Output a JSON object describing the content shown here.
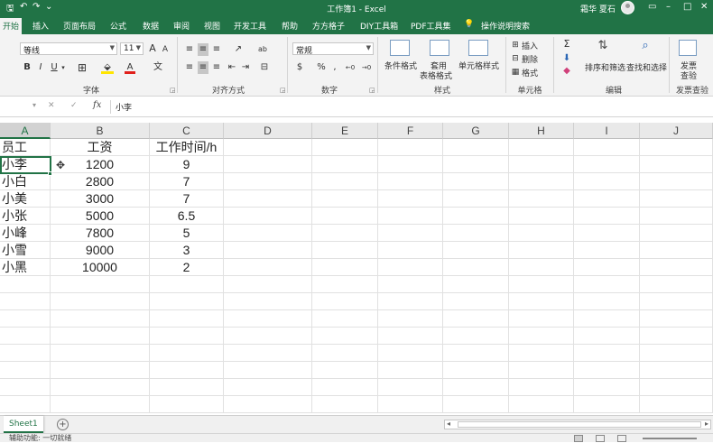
{
  "window": {
    "title": "工作簿1  -  Excel",
    "user": "霜华 夏石",
    "accent": "#217346"
  },
  "quick_access": {
    "save_icon": "save-icon",
    "undo_icon": "undo-icon",
    "redo_icon": "redo-icon",
    "glyph_save": "🖫",
    "glyph_undo": "↶",
    "glyph_redo": "↷",
    "glyph_more": "⌄"
  },
  "window_controls": {
    "minimize": "–",
    "maximize": "□",
    "close": "✕",
    "ribbon_opts": "▭"
  },
  "tabs": [
    "开始",
    "插入",
    "页面布局",
    "公式",
    "数据",
    "审阅",
    "视图",
    "开发工具",
    "帮助",
    "方方格子",
    "DIY工具箱",
    "PDF工具集",
    "操作说明搜索"
  ],
  "tell_me_icon": "💡",
  "ribbon": {
    "font_name": "等线",
    "font_size": "11",
    "number_format": "常规",
    "bold": "B",
    "italic": "I",
    "underline": "U",
    "grow_font": "A",
    "shrink_font": "A",
    "font_color": "A",
    "wen": "文",
    "percent": "%",
    "comma": ",",
    "currency": "$",
    "wrap": "ab",
    "groups": {
      "font": "字体",
      "alignment": "对齐方式",
      "number": "数字",
      "styles": "样式",
      "cells": "单元格",
      "editing": "编辑",
      "invoice": "发票查验"
    },
    "styles": {
      "conditional": "条件格式",
      "table_line1": "套用",
      "table_line2": "表格格式",
      "cell_styles": "单元格样式"
    },
    "cells": {
      "insert": "插入",
      "delete": "删除",
      "format": "格式"
    },
    "editing": {
      "sigma": "Σ",
      "sort": "排序和筛选",
      "find": "查找和选择"
    },
    "invoice": {
      "line1": "发票",
      "line2": "查验"
    }
  },
  "formula_bar": {
    "name_box": "",
    "cancel": "✕",
    "enter": "✓",
    "fx": "fx",
    "value": "小李"
  },
  "columns": [
    "A",
    "B",
    "C",
    "D",
    "E",
    "F",
    "G",
    "H",
    "I",
    "J"
  ],
  "table": {
    "headers": [
      "员工",
      "工资",
      "工作时间/h"
    ],
    "rows": [
      [
        "小李",
        "1200",
        "9"
      ],
      [
        "小白",
        "2800",
        "7"
      ],
      [
        "小美",
        "3000",
        "7"
      ],
      [
        "小张",
        "5000",
        "6.5"
      ],
      [
        "小峰",
        "7800",
        "5"
      ],
      [
        "小雪",
        "9000",
        "3"
      ],
      [
        "小黑",
        "10000",
        "2"
      ]
    ]
  },
  "selected_cell": "A2",
  "sheets": [
    "Sheet1"
  ],
  "add_sheet": "+",
  "status": {
    "text": "辅助功能: 一切就绪"
  }
}
